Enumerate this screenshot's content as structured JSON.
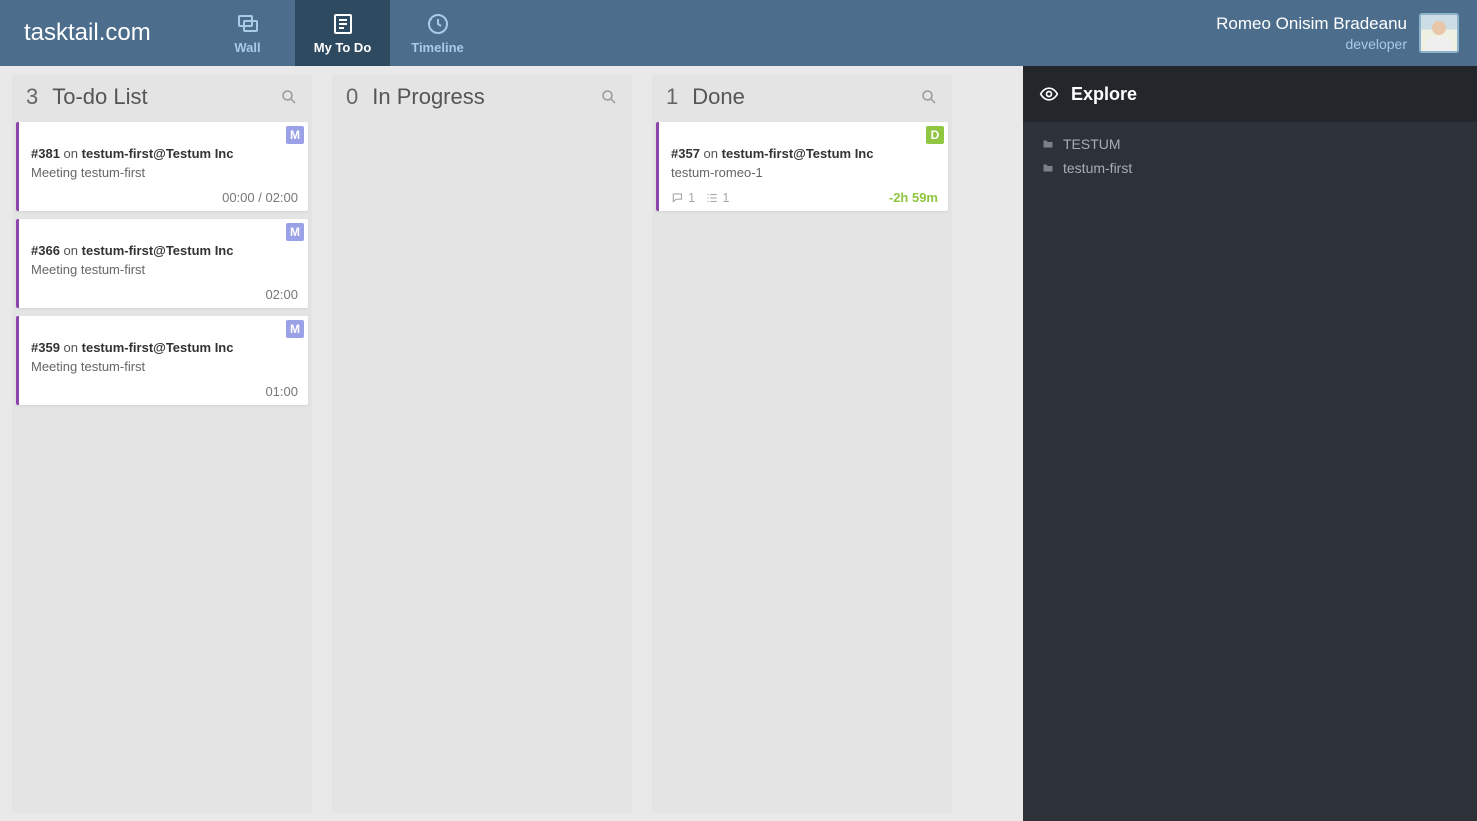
{
  "brand": "tasktail.com",
  "nav": {
    "wall": "Wall",
    "mytodo": "My To Do",
    "timeline": "Timeline",
    "active": "mytodo"
  },
  "user": {
    "name": "Romeo Onisim Bradeanu",
    "role": "developer"
  },
  "columns": [
    {
      "id": "todo",
      "count": "3",
      "title": "To-do List",
      "cards": [
        {
          "badge": "M",
          "badgeClass": "m",
          "ref": "#381",
          "on": "on",
          "project": "testum-first@Testum Inc",
          "desc": "Meeting testum-first",
          "footer_left_text": "",
          "footer_right_text": "00:00 / 02:00",
          "footer_right_class": "time-grey",
          "comments": "",
          "checklist": ""
        },
        {
          "badge": "M",
          "badgeClass": "m",
          "ref": "#366",
          "on": "on",
          "project": "testum-first@Testum Inc",
          "desc": "Meeting testum-first",
          "footer_left_text": "",
          "footer_right_text": "02:00",
          "footer_right_class": "time-grey",
          "comments": "",
          "checklist": ""
        },
        {
          "badge": "M",
          "badgeClass": "m",
          "ref": "#359",
          "on": "on",
          "project": "testum-first@Testum Inc",
          "desc": "Meeting testum-first",
          "footer_left_text": "",
          "footer_right_text": "01:00",
          "footer_right_class": "time-grey",
          "comments": "",
          "checklist": ""
        }
      ]
    },
    {
      "id": "inprogress",
      "count": "0",
      "title": "In Progress",
      "cards": []
    },
    {
      "id": "done",
      "count": "1",
      "title": "Done",
      "cards": [
        {
          "badge": "D",
          "badgeClass": "d",
          "ref": "#357",
          "on": "on",
          "project": "testum-first@Testum Inc",
          "desc": "testum-romeo-1",
          "footer_left_text": "",
          "footer_right_text": "-2h 59m",
          "footer_right_class": "time-green",
          "comments": "1",
          "checklist": "1"
        }
      ]
    }
  ],
  "sidebar": {
    "title": "Explore",
    "tree": [
      {
        "label": "TESTUM"
      },
      {
        "label": "testum-first"
      }
    ]
  }
}
